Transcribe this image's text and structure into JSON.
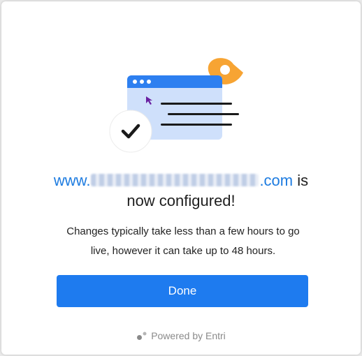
{
  "dialog": {
    "domain_prefix": "www.",
    "domain_suffix": ".com",
    "headline_tail": " is",
    "headline_line2": "now configured!",
    "message_line1": "Changes typically take less than a few hours to go",
    "message_line2": "live, however it can take up to 48 hours.",
    "done_label": "Done",
    "powered_by": "Powered by Entri"
  },
  "icons": {
    "illustration": "browser-window-illustration",
    "check": "checkmark-icon",
    "cursor": "mouse-cursor-icon",
    "entri": "entri-logo-icon"
  },
  "colors": {
    "primary": "#1e7bef",
    "link": "#1e7ce0",
    "accent_orange": "#f7a433",
    "window_light_blue": "#cfe0fb"
  }
}
